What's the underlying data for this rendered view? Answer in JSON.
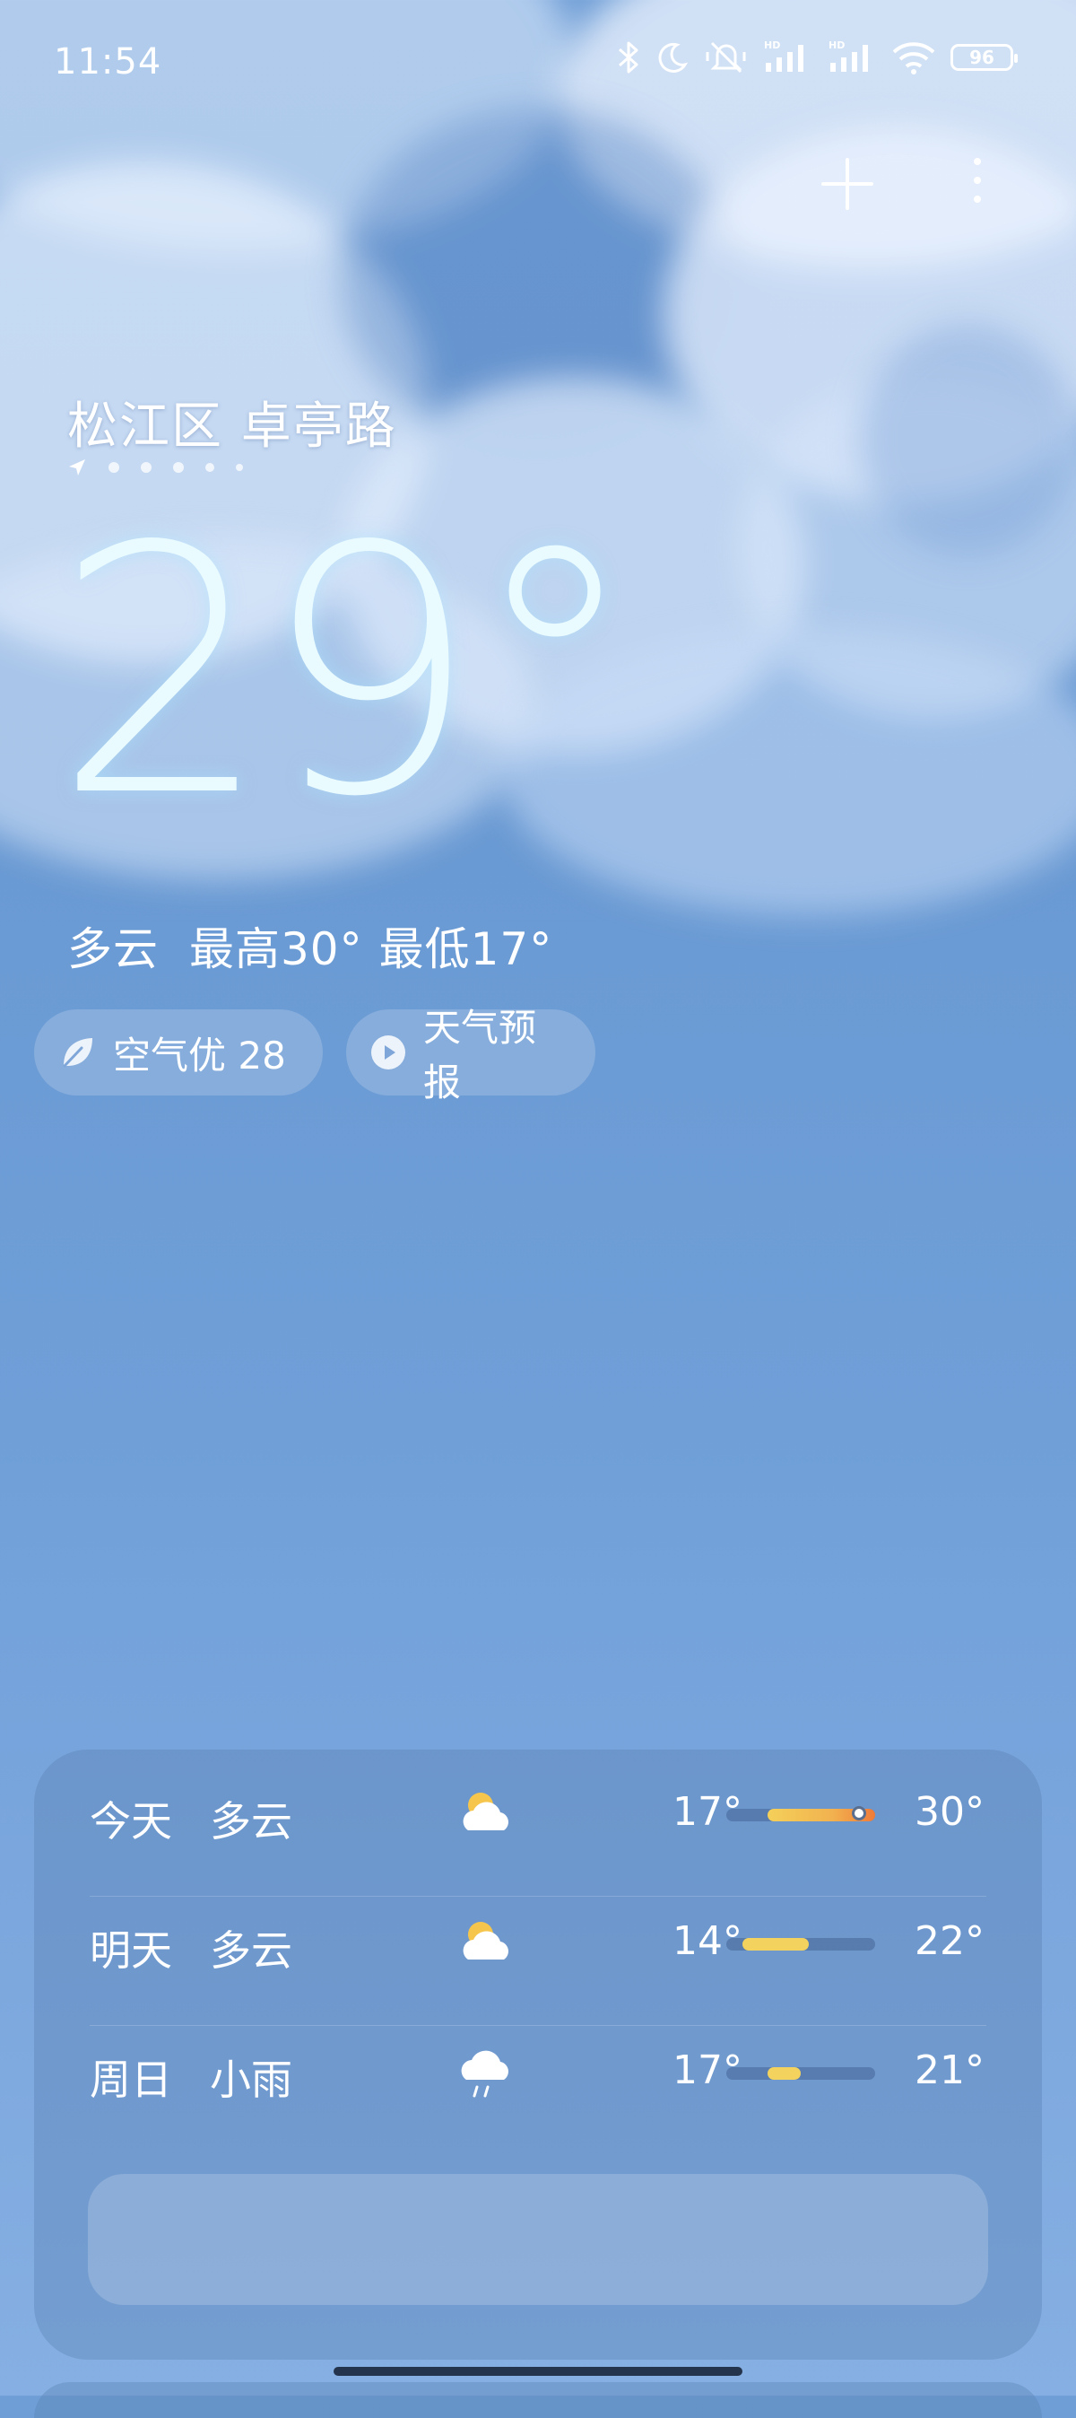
{
  "status_bar": {
    "time": "11:54",
    "battery": "96",
    "icons": [
      "bluetooth-icon",
      "moon-icon",
      "mute-icon",
      "hd-signal-icon",
      "hd-signal-icon",
      "wifi-icon",
      "battery-icon"
    ],
    "hd_label": "HD"
  },
  "header": {
    "add_icon": "plus-icon",
    "more_icon": "more-vertical-icon"
  },
  "location": {
    "name": "松江区 卓亭路",
    "pages_count": 6
  },
  "current": {
    "temperature": "29°",
    "condition": "多云",
    "high": "最高30°",
    "low": "最低17°"
  },
  "pills": {
    "aqi_label": "空气优 28",
    "forecast_label": "天气预报"
  },
  "forecast": {
    "days": [
      {
        "day": "今天",
        "condition": "多云",
        "icon": "partly-cloudy-icon",
        "low": "17°",
        "high": "30°",
        "range_start": 0.28,
        "range_end": 1.0,
        "current_marker": 0.9
      },
      {
        "day": "明天",
        "condition": "多云",
        "icon": "partly-cloudy-icon",
        "low": "14°",
        "high": "22°",
        "range_start": 0.1,
        "range_end": 0.55
      },
      {
        "day": "周日",
        "condition": "小雨",
        "icon": "light-rain-icon",
        "low": "17°",
        "high": "21°",
        "range_start": 0.28,
        "range_end": 0.5
      }
    ]
  },
  "colors": {
    "sky_top": "#6f9ed6",
    "sky_bottom": "#86b0e3",
    "bar_warm": "#f2b24f",
    "bar_hot": "#ef7b3a",
    "bar_mild": "#f3d35e",
    "temp_glow": "#e9fbff"
  }
}
